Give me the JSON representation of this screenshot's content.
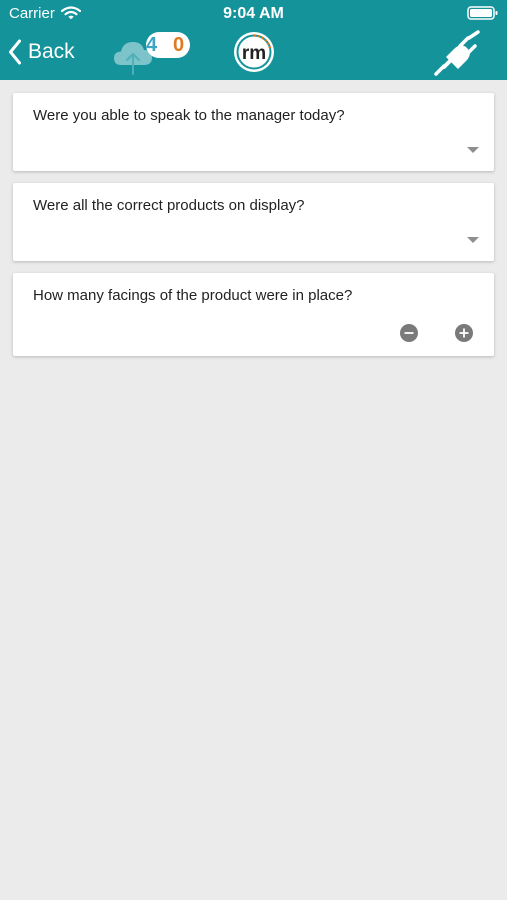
{
  "status_bar": {
    "carrier": "Carrier",
    "time": "9:04 AM"
  },
  "nav": {
    "back_label": "Back",
    "sync": {
      "pending_count": "4",
      "failed_count": "0",
      "pending_color": "#3fa5c4",
      "failed_color": "#e07a21"
    },
    "logo_text": "rm"
  },
  "theme": {
    "header_bg": "#14939a",
    "page_bg": "#ebebeb",
    "card_bg": "#ffffff"
  },
  "questions": [
    {
      "text": "Were you able to speak to the manager today?",
      "input": "dropdown",
      "value": ""
    },
    {
      "text": "Were all the correct products on display?",
      "input": "dropdown",
      "value": ""
    },
    {
      "text": "How many facings of the product were in place?",
      "input": "stepper",
      "value": ""
    }
  ],
  "icons": {
    "wifi": "wifi-icon",
    "battery": "battery-icon",
    "back": "chevron-left-icon",
    "sync": "cloud-upload-icon",
    "logo": "rm-logo",
    "connection": "plug-icon",
    "dropdown": "caret-down-icon",
    "minus": "minus-circle-icon",
    "plus": "plus-circle-icon"
  }
}
